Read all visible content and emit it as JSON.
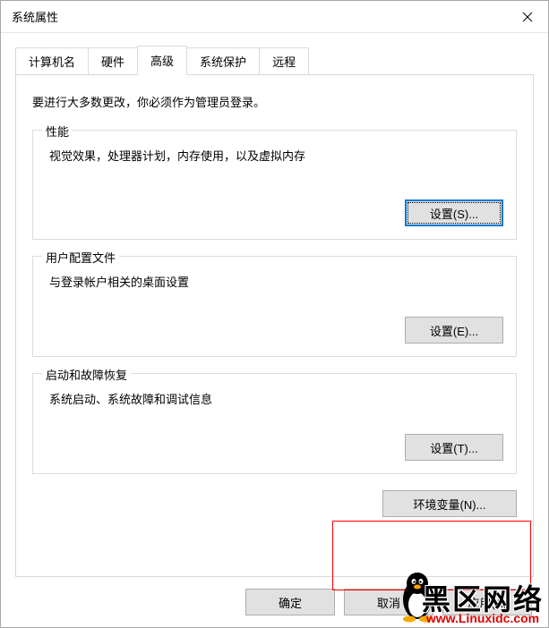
{
  "window": {
    "title": "系统属性"
  },
  "tabs": {
    "items": [
      {
        "label": "计算机名"
      },
      {
        "label": "硬件"
      },
      {
        "label": "高级"
      },
      {
        "label": "系统保护"
      },
      {
        "label": "远程"
      }
    ],
    "active_index": 2
  },
  "advanced_panel": {
    "instruction": "要进行大多数更改，你必须作为管理员登录。",
    "performance": {
      "title": "性能",
      "desc": "视觉效果，处理器计划，内存使用，以及虚拟内存",
      "settings_label": "设置(S)..."
    },
    "user_profiles": {
      "title": "用户配置文件",
      "desc": "与登录帐户相关的桌面设置",
      "settings_label": "设置(E)..."
    },
    "startup_recovery": {
      "title": "启动和故障恢复",
      "desc": "系统启动、系统故障和调试信息",
      "settings_label": "设置(T)..."
    },
    "env_vars_label": "环境变量(N)..."
  },
  "dialog_buttons": {
    "ok": "确定",
    "cancel": "取消",
    "apply": "应用(A)"
  },
  "watermark": {
    "cn": "黑区网络",
    "url": "www.Linuxidc.com"
  }
}
